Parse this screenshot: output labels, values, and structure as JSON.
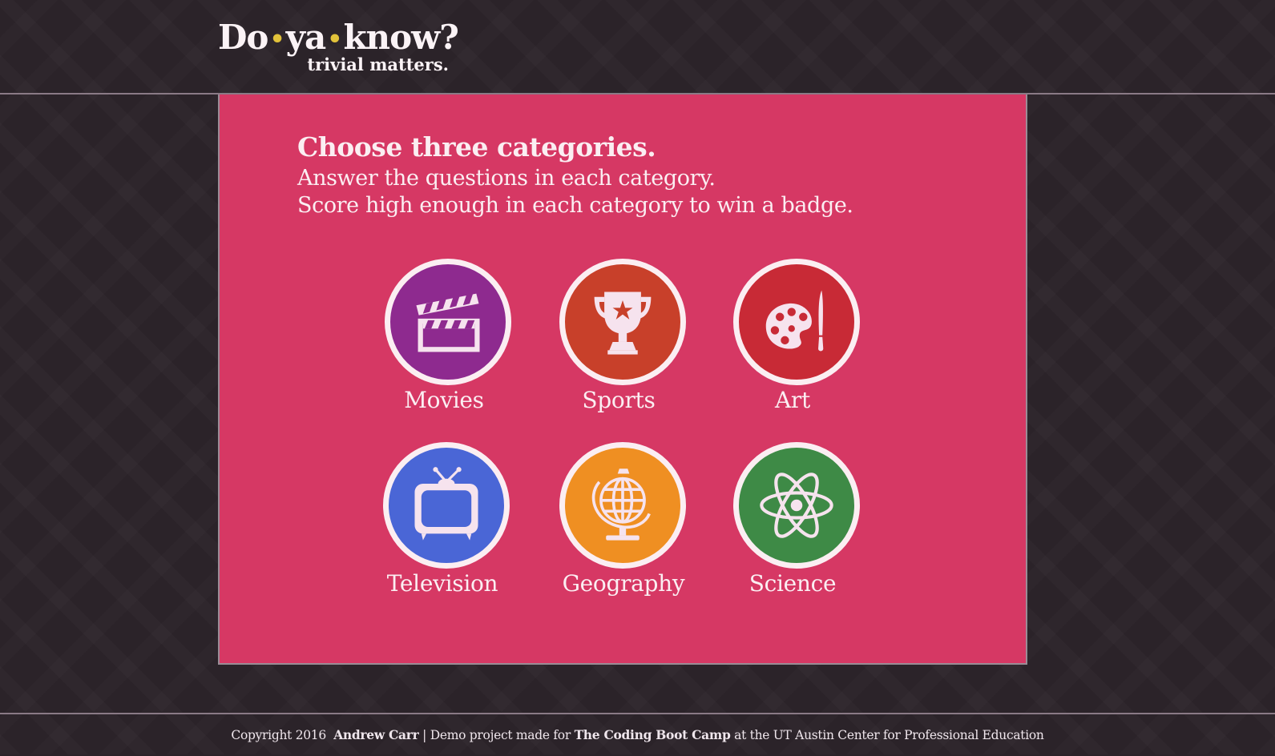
{
  "header": {
    "logo_word1": "Do",
    "logo_word2": "ya",
    "logo_word3": "know?",
    "logo_dot": "•",
    "tagline": "trivial matters."
  },
  "intro": {
    "heading": "Choose three categories.",
    "line1": "Answer the questions in each category.",
    "line2": "Score high enough in each category to win a badge."
  },
  "categories": [
    {
      "label": "Movies",
      "icon": "clapperboard-icon",
      "color": "#8e2a8f"
    },
    {
      "label": "Sports",
      "icon": "trophy-icon",
      "color": "#c8402a"
    },
    {
      "label": "Art",
      "icon": "palette-icon",
      "color": "#c82a36"
    },
    {
      "label": "Television",
      "icon": "tv-icon",
      "color": "#4a66d6"
    },
    {
      "label": "Geography",
      "icon": "globe-icon",
      "color": "#ef8f22"
    },
    {
      "label": "Science",
      "icon": "atom-icon",
      "color": "#3e8a46"
    }
  ],
  "footer": {
    "copyright": "Copyright 2016",
    "author": "Andrew Carr",
    "sep": "|",
    "demo": "Demo project made for",
    "bootcamp": "The Coding Boot Camp",
    "rest": "at the UT Austin Center for Professional Education"
  },
  "colors": {
    "background": "#2b2329",
    "panel": "#d63864",
    "accent_dot": "#e2c23a",
    "text_light": "#fbeef2"
  }
}
